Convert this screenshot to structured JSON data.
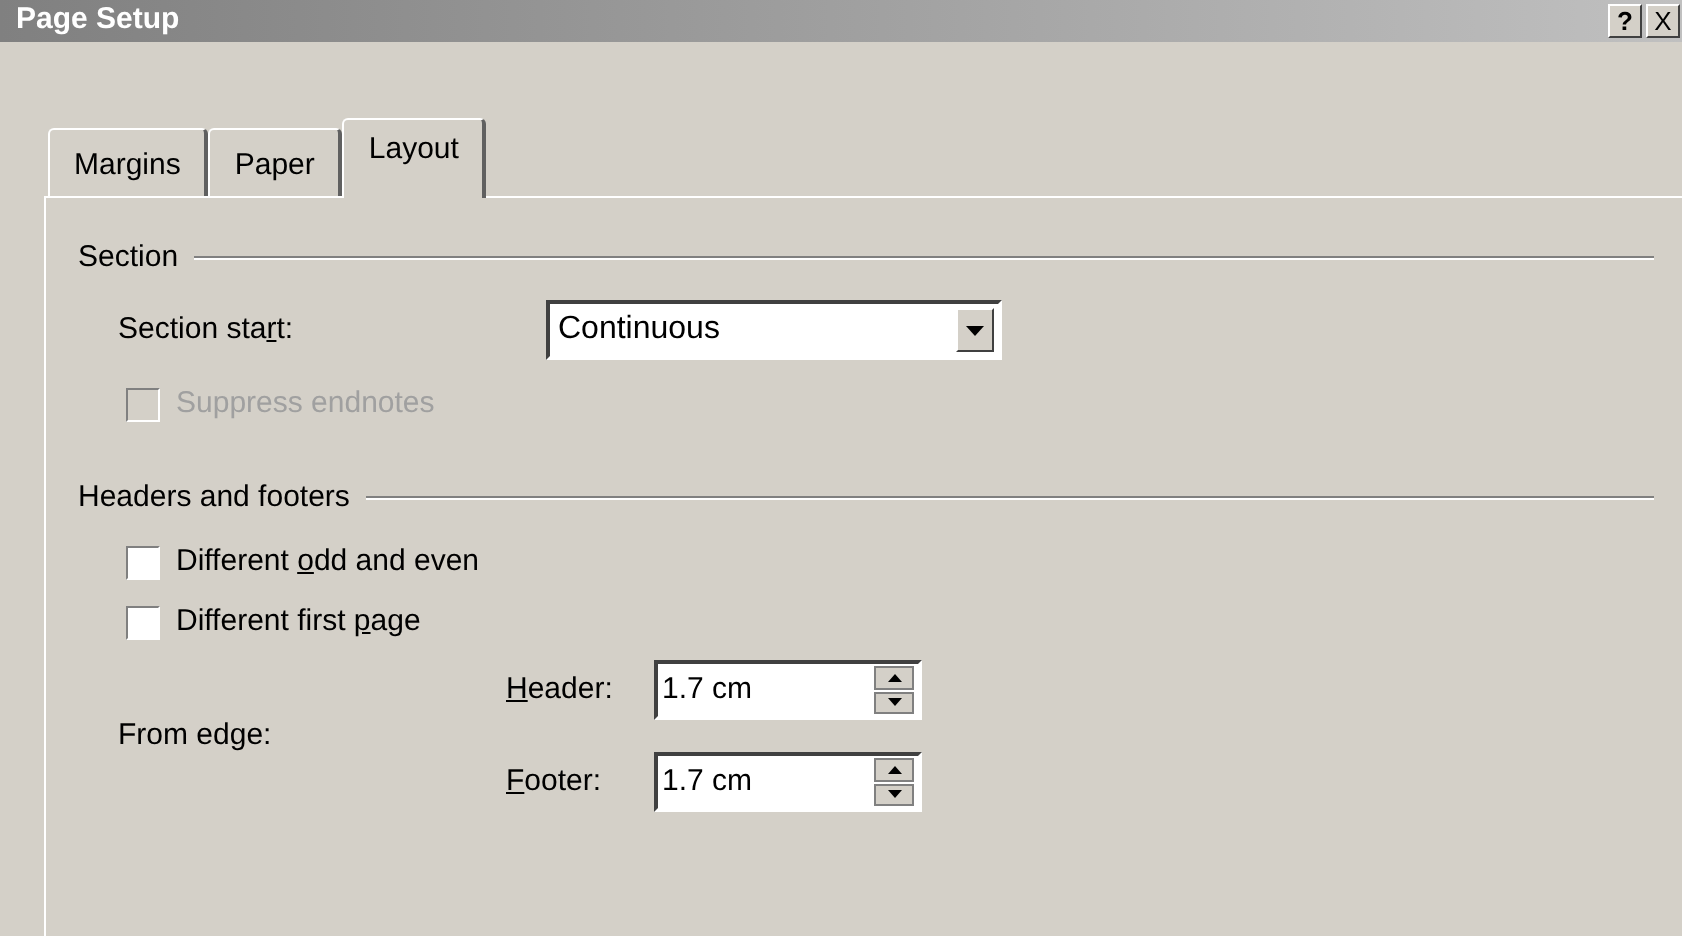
{
  "window": {
    "title": "Page Setup",
    "buttons": [
      {
        "kind": "help",
        "label": "?"
      },
      {
        "kind": "close",
        "label": "X"
      }
    ]
  },
  "tabs": [
    {
      "label": "Margins",
      "selected": false
    },
    {
      "label": "Paper",
      "selected": false
    },
    {
      "label": "Layout",
      "selected": true
    }
  ],
  "section": {
    "heading": "Section",
    "section_start": {
      "label_parts": [
        "Section sta",
        "r",
        "t:"
      ],
      "value": "Continuous"
    },
    "suppress_endnotes": {
      "label": "Suppress endnotes",
      "checked": false,
      "disabled": true
    }
  },
  "headers_and_footers": {
    "heading": "Headers and footers",
    "checkboxes": [
      {
        "label_parts": [
          "Different ",
          "o",
          "dd and even"
        ],
        "checked": false,
        "disabled": false
      },
      {
        "label_parts": [
          "Different first ",
          "p",
          "age"
        ],
        "checked": false,
        "disabled": false
      }
    ],
    "from_edge": {
      "label": "From edge:",
      "fields": [
        {
          "label_parts": [
            "H",
            "eader:"
          ],
          "value": "1.7 cm"
        },
        {
          "label_parts": [
            "F",
            "ooter:"
          ],
          "value": "1.7 cm"
        }
      ]
    }
  }
}
